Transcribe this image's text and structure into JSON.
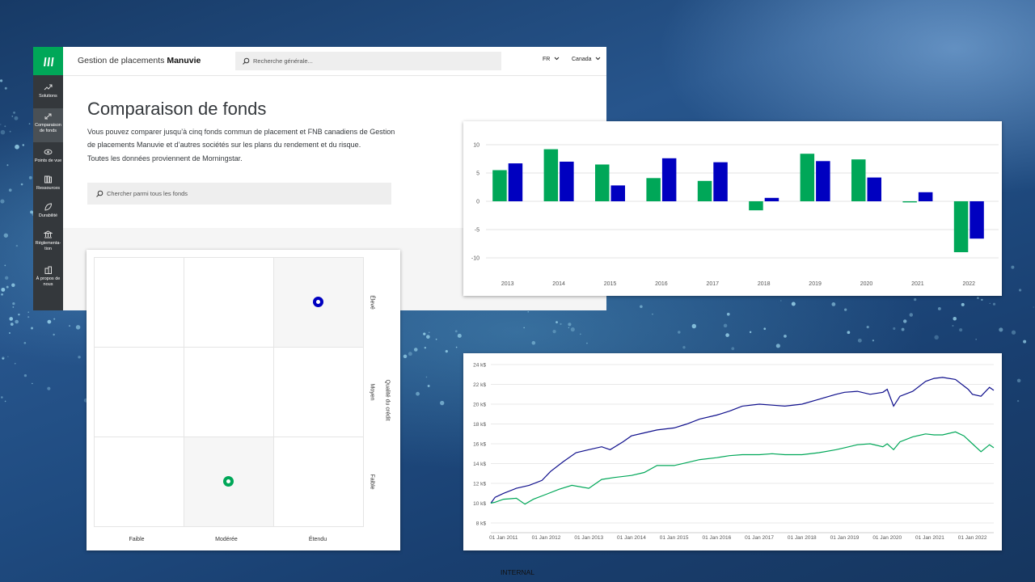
{
  "site": {
    "brand_prefix": "Gestion de placements",
    "brand_name": "Manuvie",
    "search_placeholder": "Recherche générale...",
    "language": "FR",
    "country": "Canada",
    "sidebar": [
      {
        "label": "Solutions",
        "icon": "trend-icon"
      },
      {
        "label": "Comparaison de fonds",
        "icon": "compare-arrows-icon"
      },
      {
        "label": "Points de vue",
        "icon": "eye-icon"
      },
      {
        "label": "Ressources",
        "icon": "books-icon"
      },
      {
        "label": "Durabilité",
        "icon": "leaf-icon"
      },
      {
        "label": "Réglementa-tion",
        "icon": "building-icon"
      },
      {
        "label": "À propos de nous",
        "icon": "office-icon"
      }
    ],
    "page_title": "Comparaison de fonds",
    "description_lines": [
      "Vous pouvez comparer jusqu’à cinq fonds commun de placement et FNB canadiens de Gestion",
      "de placements Manuvie et d’autres sociétés sur les plans du rendement et du risque.",
      "Toutes les données proviennent de Morningstar."
    ],
    "fund_search_placeholder": "Chercher parmi tous les fonds"
  },
  "style_box": {
    "x_labels": [
      "Faible",
      "Modérée",
      "Étendu"
    ],
    "y_labels": [
      "Élevé",
      "Moyen",
      "Faible"
    ],
    "y_axis_title": "Qualité du crédit",
    "points": [
      {
        "series": "blue",
        "col": 2,
        "row": 0
      },
      {
        "series": "green",
        "col": 1,
        "row": 2
      }
    ],
    "shaded_cells": [
      [
        2,
        0
      ],
      [
        1,
        2
      ]
    ],
    "colors": {
      "blue": "#0000c0",
      "green": "#00a758"
    }
  },
  "chart_data": [
    {
      "type": "bar",
      "categories": [
        "2013",
        "2014",
        "2015",
        "2016",
        "2017",
        "2018",
        "2019",
        "2020",
        "2021",
        "2022"
      ],
      "series": [
        {
          "values": [
            5.5,
            9.2,
            6.5,
            4.1,
            3.6,
            -1.6,
            8.4,
            7.4,
            -0.2,
            -9.0
          ],
          "color": "#00a758"
        },
        {
          "values": [
            6.7,
            7.0,
            2.8,
            7.6,
            6.9,
            0.6,
            7.1,
            4.2,
            1.6,
            -6.6
          ],
          "color": "#0000c0"
        }
      ],
      "yticks": [
        10,
        5,
        0,
        -5,
        -10
      ],
      "ylim": [
        -11,
        11
      ],
      "grid": true
    },
    {
      "type": "line",
      "x_tick_labels": [
        "01 Jan 2011",
        "01 Jan 2012",
        "01 Jan 2013",
        "01 Jan 2014",
        "01 Jan 2015",
        "01 Jan 2016",
        "01 Jan 2017",
        "01 Jan 2018",
        "01 Jan 2019",
        "01 Jan 2020",
        "01 Jan 2021",
        "01 Jan 2022"
      ],
      "y_tick_labels": [
        "24 k$",
        "22 k$",
        "20 k$",
        "18 k$",
        "16 k$",
        "14 k$",
        "12 k$",
        "10 k$",
        "8 k$"
      ],
      "ylim": [
        8,
        24
      ],
      "x_range": [
        2010.7,
        2022.5
      ],
      "grid": true,
      "series": [
        {
          "color": "#0f0f8c",
          "x": [
            2010.7,
            2010.8,
            2011.0,
            2011.3,
            2011.6,
            2011.9,
            2012.1,
            2012.4,
            2012.7,
            2013.0,
            2013.3,
            2013.5,
            2013.8,
            2014.0,
            2014.3,
            2014.6,
            2015.0,
            2015.3,
            2015.6,
            2016.0,
            2016.3,
            2016.6,
            2017.0,
            2017.3,
            2017.6,
            2018.0,
            2018.4,
            2018.8,
            2019.0,
            2019.3,
            2019.6,
            2019.9,
            2020.0,
            2020.15,
            2020.3,
            2020.6,
            2020.9,
            2021.1,
            2021.3,
            2021.6,
            2021.9,
            2022.0,
            2022.2,
            2022.4,
            2022.5
          ],
          "y": [
            10.0,
            10.6,
            11.0,
            11.5,
            11.8,
            12.3,
            13.2,
            14.2,
            15.1,
            15.4,
            15.7,
            15.4,
            16.2,
            16.8,
            17.1,
            17.4,
            17.6,
            18.0,
            18.5,
            18.9,
            19.3,
            19.8,
            20.0,
            19.9,
            19.8,
            20.0,
            20.5,
            21.0,
            21.2,
            21.3,
            21.0,
            21.2,
            21.5,
            19.8,
            20.8,
            21.3,
            22.3,
            22.6,
            22.7,
            22.5,
            21.5,
            21.0,
            20.8,
            21.7,
            21.4
          ]
        },
        {
          "color": "#00a758",
          "x": [
            2010.7,
            2010.8,
            2011.0,
            2011.3,
            2011.5,
            2011.7,
            2012.0,
            2012.3,
            2012.6,
            2013.0,
            2013.3,
            2013.6,
            2014.0,
            2014.3,
            2014.6,
            2015.0,
            2015.3,
            2015.6,
            2016.0,
            2016.3,
            2016.6,
            2017.0,
            2017.3,
            2017.6,
            2018.0,
            2018.4,
            2018.8,
            2019.0,
            2019.3,
            2019.6,
            2019.9,
            2020.0,
            2020.15,
            2020.3,
            2020.6,
            2020.9,
            2021.1,
            2021.3,
            2021.6,
            2021.8,
            2022.0,
            2022.2,
            2022.4,
            2022.5
          ],
          "y": [
            10.0,
            10.1,
            10.4,
            10.5,
            9.9,
            10.4,
            10.9,
            11.4,
            11.8,
            11.5,
            12.4,
            12.6,
            12.8,
            13.1,
            13.8,
            13.8,
            14.1,
            14.4,
            14.6,
            14.8,
            14.9,
            14.9,
            15.0,
            14.9,
            14.9,
            15.1,
            15.4,
            15.6,
            15.9,
            16.0,
            15.7,
            16.0,
            15.4,
            16.2,
            16.7,
            17.0,
            16.9,
            16.9,
            17.2,
            16.8,
            16.0,
            15.2,
            15.9,
            15.6
          ]
        }
      ]
    }
  ],
  "footer": "INTERNAL"
}
